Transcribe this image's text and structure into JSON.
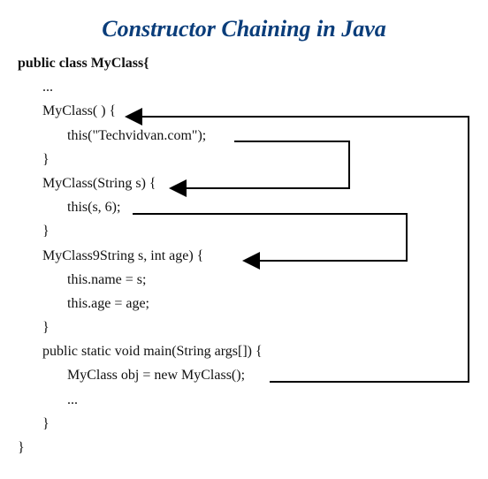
{
  "title": "Constructor Chaining in Java",
  "code": {
    "l1": "public class MyClass{",
    "l2": "...",
    "l3a": "MyClass( ) {",
    "l4": "this(\"Techvidvan.com\");",
    "l5": "}",
    "l6a": "MyClass(String s) {",
    "l7": "this(s, 6);",
    "l8": "}",
    "l9a": "MyClass9String s, int age) {",
    "l10": "this.name = s;",
    "l11": "this.age = age;",
    "l12": "}",
    "l13": "public static void main(String args[]) {",
    "l14": "MyClass obj = new MyClass();",
    "l15": "...",
    "l16": "}",
    "l17": "}"
  }
}
